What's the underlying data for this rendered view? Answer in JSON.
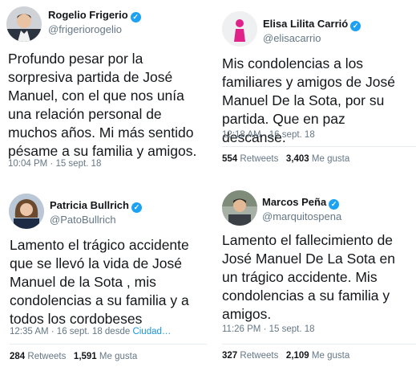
{
  "tweets": [
    {
      "name": "Rogelio Frigerio",
      "handle": "@frigeriorogelio",
      "text": "Profundo pesar por la sorpresiva partida de José Manuel, con el que nos unía una relación personal de muchos años. Mi más sentido pésame a su familia y amigos.",
      "time": "10:04 PM · 15 sept. 18"
    },
    {
      "name": "Elisa Lilita Carrió",
      "handle": "@elisacarrio",
      "text": "Mis condolencias a los familiares y amigos de José Manuel De la Sota,  por su partida. Que en paz descanse.",
      "time": "12:18 AM · 16 sept. 18",
      "retweets": "554",
      "retweets_label": "Retweets",
      "likes": "3,403",
      "likes_label": "Me gusta"
    },
    {
      "name": "Patricia Bullrich",
      "handle": "@PatoBullrich",
      "text": "Lamento el trágico accidente que se llevó la vida de José Manuel de la Sota , mis condolencias a su familia y a todos los cordobeses",
      "time": "12:35 AM · 16 sept. 18 desde ",
      "source": "Ciudad…",
      "retweets": "284",
      "retweets_label": "Retweets",
      "likes": "1,591",
      "likes_label": "Me gusta"
    },
    {
      "name": "Marcos Peña",
      "handle": "@marquitospena",
      "text": "Lamento el fallecimiento de José Manuel De La Sota en un trágico accidente. Mis condolencias a su familia y amigos.",
      "time": "11:26 PM · 15 sept. 18",
      "retweets": "327",
      "retweets_label": "Retweets",
      "likes": "2,109",
      "likes_label": "Me gusta"
    }
  ]
}
